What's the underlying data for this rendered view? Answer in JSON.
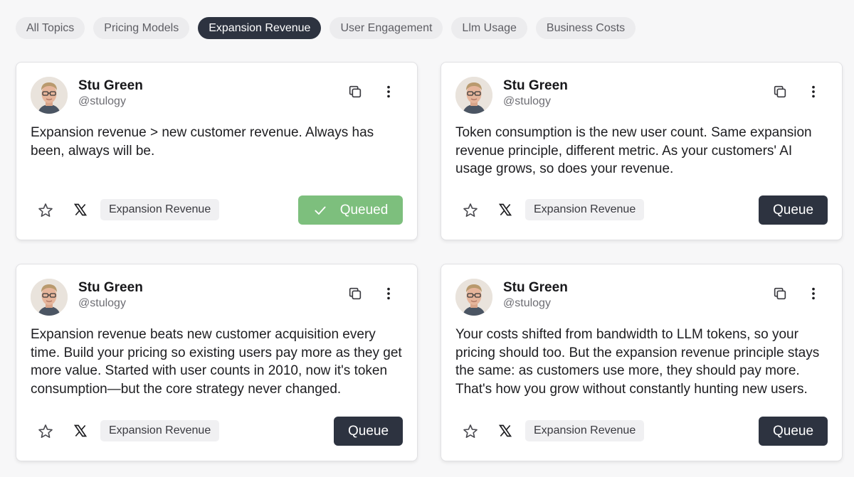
{
  "filters": [
    {
      "label": "All Topics",
      "active": false
    },
    {
      "label": "Pricing Models",
      "active": false
    },
    {
      "label": "Expansion Revenue",
      "active": true
    },
    {
      "label": "User Engagement",
      "active": false
    },
    {
      "label": "Llm Usage",
      "active": false
    },
    {
      "label": "Business Costs",
      "active": false
    }
  ],
  "cards": [
    {
      "author": "Stu Green",
      "handle": "@stulogy",
      "text": "Expansion revenue > new customer revenue. Always has been, always will be.",
      "tag": "Expansion Revenue",
      "button": "Queued",
      "queued": true
    },
    {
      "author": "Stu Green",
      "handle": "@stulogy",
      "text": "Token consumption is the new user count. Same expansion revenue principle, different metric. As your customers' AI usage grows, so does your revenue.",
      "tag": "Expansion Revenue",
      "button": "Queue",
      "queued": false
    },
    {
      "author": "Stu Green",
      "handle": "@stulogy",
      "text": "Expansion revenue beats new customer acquisition every time. Build your pricing so existing users pay more as they get more value. Started with user counts in 2010, now it's token consumption—but the core strategy never changed.",
      "tag": "Expansion Revenue",
      "button": "Queue",
      "queued": false
    },
    {
      "author": "Stu Green",
      "handle": "@stulogy",
      "text": "Your costs shifted from bandwidth to LLM tokens, so your pricing should too. But the expansion revenue principle stays the same: as customers use more, they should pay more. That's how you grow without constantly hunting new users.",
      "tag": "Expansion Revenue",
      "button": "Queue",
      "queued": false
    }
  ],
  "colors": {
    "accent_dark": "#2d3340",
    "queued_green": "#7dbf7d",
    "chip_bg": "#ececee"
  },
  "icons": [
    "copy-icon",
    "more-vertical-icon",
    "star-icon",
    "x-logo-icon",
    "check-icon"
  ]
}
